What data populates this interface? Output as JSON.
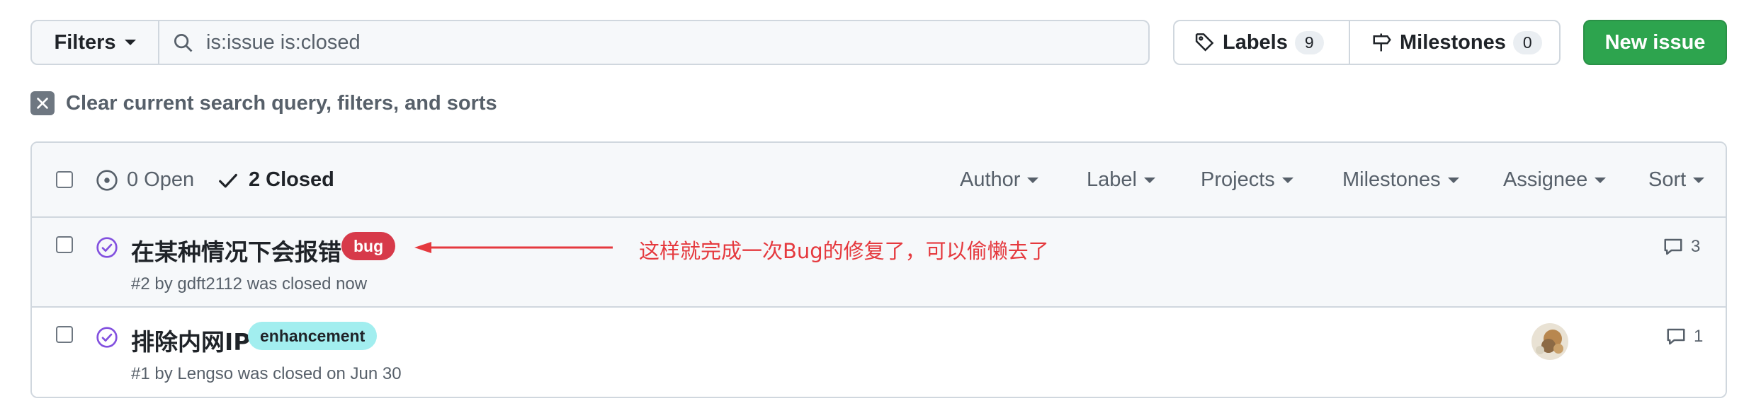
{
  "toolbar": {
    "filters_label": "Filters",
    "search_value": "is:issue is:closed",
    "labels_label": "Labels",
    "labels_count": "9",
    "milestones_label": "Milestones",
    "milestones_count": "0",
    "new_issue_label": "New issue"
  },
  "clear_filters_label": "Clear current search query, filters, and sorts",
  "list_header": {
    "open_label": "0 Open",
    "closed_label": "2 Closed",
    "filters": [
      "Author",
      "Label",
      "Projects",
      "Milestones",
      "Assignee",
      "Sort"
    ]
  },
  "issues": [
    {
      "title": "在某种情况下会报错",
      "label": "bug",
      "label_bg": "#d73a4a",
      "label_fg": "#ffffff",
      "meta": "#2 by gdft2112 was closed now",
      "comments": "3"
    },
    {
      "title": "排除内网IP",
      "label": "enhancement",
      "label_bg": "#a2eeef",
      "label_fg": "#1f2328",
      "meta": "#1 by Lengso was closed on Jun 30",
      "comments": "1"
    }
  ],
  "annotation": {
    "text": "这样就完成一次Bug的修复了，可以偷懒去了",
    "color": "#e5393e"
  },
  "colors": {
    "closed_purple": "#8250df",
    "primary_green": "#2da44e"
  }
}
